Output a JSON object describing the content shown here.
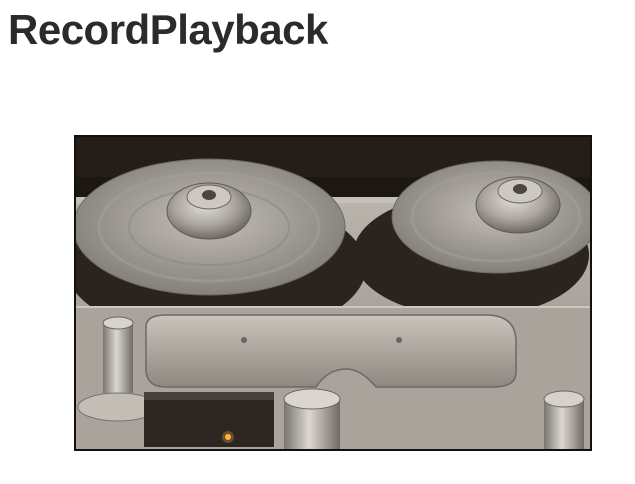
{
  "page": {
    "title": "RecordPlayback"
  },
  "photo": {
    "subject": "reel-to-reel-tape-recorder",
    "colors": {
      "deck": "#a8a39b",
      "reel": "#9b9791",
      "tape": "#2a231e",
      "background": "#1a1410"
    }
  }
}
